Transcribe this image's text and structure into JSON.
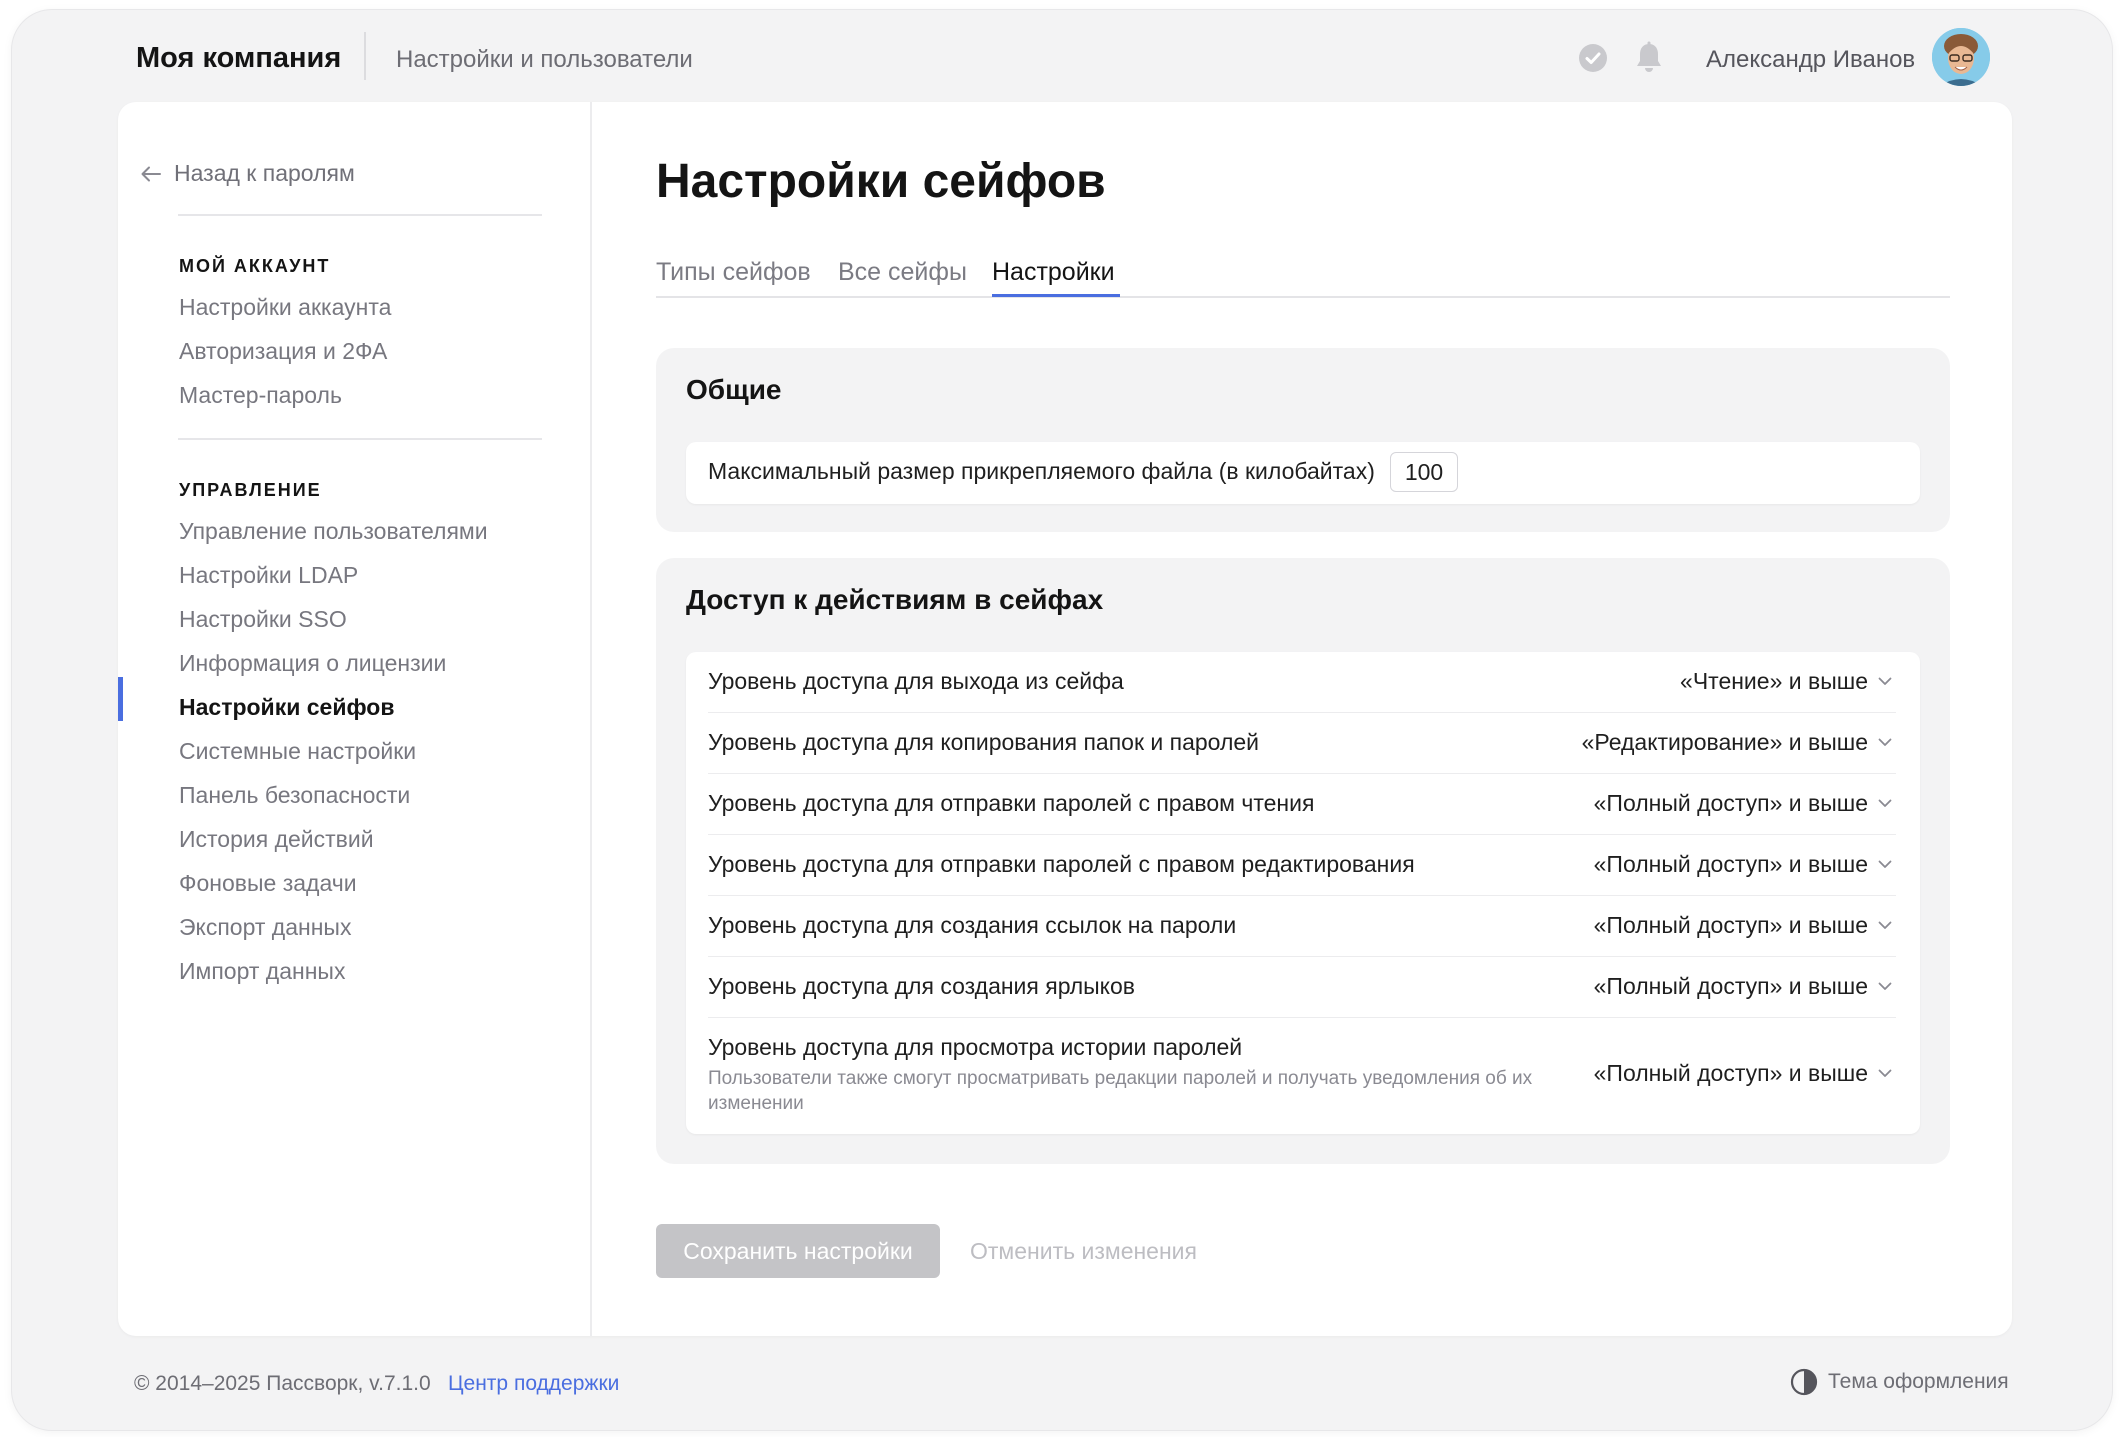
{
  "header": {
    "company": "Моя компания",
    "section": "Настройки и пользователи",
    "user_name": "Александр Иванов"
  },
  "sidebar": {
    "back_label": "Назад к паролям",
    "groups": [
      {
        "heading": "МОЙ АККАУНТ",
        "items": [
          "Настройки аккаунта",
          "Авторизация и 2ФА",
          "Мастер-пароль"
        ]
      },
      {
        "heading": "УПРАВЛЕНИЕ",
        "items": [
          "Управление пользователями",
          "Настройки LDAP",
          "Настройки SSO",
          "Информация о лицензии",
          "Настройки сейфов",
          "Системные настройки",
          "Панель безопасности",
          "История действий",
          "Фоновые задачи",
          "Экспорт данных",
          "Импорт данных"
        ]
      }
    ],
    "active_item": "Настройки сейфов"
  },
  "main": {
    "title": "Настройки сейфов",
    "tabs": [
      {
        "label": "Типы сейфов",
        "active": false
      },
      {
        "label": "Все сейфы",
        "active": false
      },
      {
        "label": "Настройки",
        "active": true
      }
    ],
    "general": {
      "title": "Общие",
      "file_size_label": "Максимальный размер прикрепляемого файла (в килобайтах)",
      "file_size_value": "100"
    },
    "access": {
      "title": "Доступ к действиям в сейфах",
      "rows": [
        {
          "label": "Уровень доступа для выхода из сейфа",
          "value": "«Чтение» и выше"
        },
        {
          "label": "Уровень доступа для копирования папок и паролей",
          "value": "«Редактирование» и выше"
        },
        {
          "label": "Уровень доступа для отправки паролей с правом чтения",
          "value": "«Полный доступ» и выше"
        },
        {
          "label": "Уровень доступа для отправки паролей с правом редактирования",
          "value": "«Полный доступ» и выше"
        },
        {
          "label": "Уровень доступа для создания ссылок на пароли",
          "value": "«Полный доступ» и выше"
        },
        {
          "label": "Уровень доступа для создания ярлыков",
          "value": "«Полный доступ» и выше"
        },
        {
          "label": "Уровень доступа для просмотра истории паролей",
          "value": "«Полный доступ» и выше",
          "hint": "Пользователи также смогут просматривать редакции паролей и получать уведомления об их изменении"
        }
      ]
    },
    "save_label": "Сохранить настройки",
    "cancel_label": "Отменить изменения"
  },
  "footer": {
    "copyright": "© 2014–2025 Пассворк, v.7.1.0",
    "support_label": "Центр поддержки",
    "theme_label": "Тема оформления"
  },
  "colors": {
    "accent": "#4a6ee0",
    "background": "#f3f3f4",
    "card": "#ffffff",
    "disabled_button": "#c4c4c7"
  },
  "icons": [
    "arrow-left-icon",
    "check-circle-icon",
    "bell-icon",
    "chevron-down-icon",
    "theme-contrast-icon"
  ]
}
